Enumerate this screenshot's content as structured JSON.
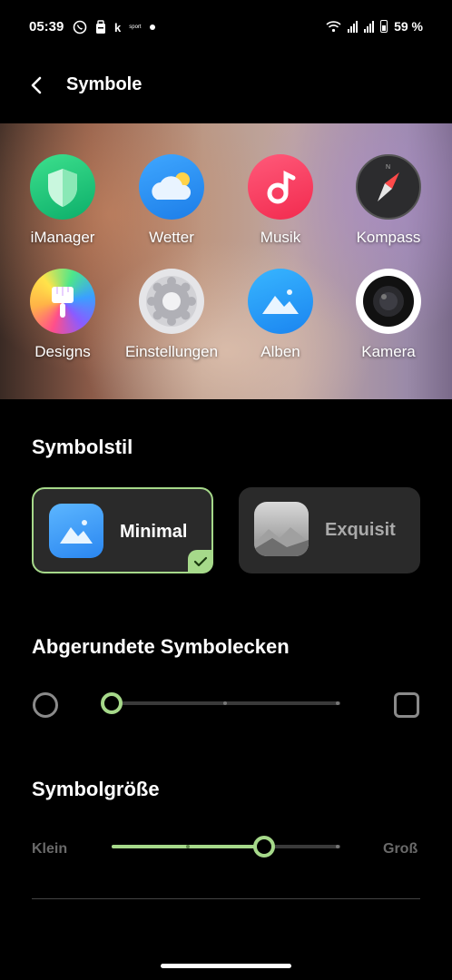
{
  "status": {
    "time": "05:39",
    "left_icons": [
      "whatsapp-icon",
      "gifts-icon",
      "k-app-icon"
    ],
    "sport_label": "sport",
    "k_label": "k",
    "battery": "59 %"
  },
  "header": {
    "title": "Symbole"
  },
  "preview": {
    "apps": [
      {
        "label": "iManager",
        "icon": "shield-icon"
      },
      {
        "label": "Wetter",
        "icon": "cloud-sun-icon"
      },
      {
        "label": "Musik",
        "icon": "music-note-icon"
      },
      {
        "label": "Kompass",
        "icon": "compass-icon"
      },
      {
        "label": "Designs",
        "icon": "paint-brush-icon"
      },
      {
        "label": "Einstellungen",
        "icon": "gear-icon"
      },
      {
        "label": "Alben",
        "icon": "mountains-icon"
      },
      {
        "label": "Kamera",
        "icon": "camera-lens-icon"
      }
    ]
  },
  "icon_style": {
    "title": "Symbolstil",
    "options": [
      {
        "label": "Minimal",
        "selected": true
      },
      {
        "label": "Exquisit",
        "selected": false
      }
    ]
  },
  "corners": {
    "title": "Abgerundete Symbolecken",
    "value_fraction": 0.0,
    "steps": 3
  },
  "size": {
    "title": "Symbolgröße",
    "min_label": "Klein",
    "max_label": "Groß",
    "value_fraction": 0.67,
    "steps": 4
  },
  "colors": {
    "accent": "#a6d98a"
  }
}
